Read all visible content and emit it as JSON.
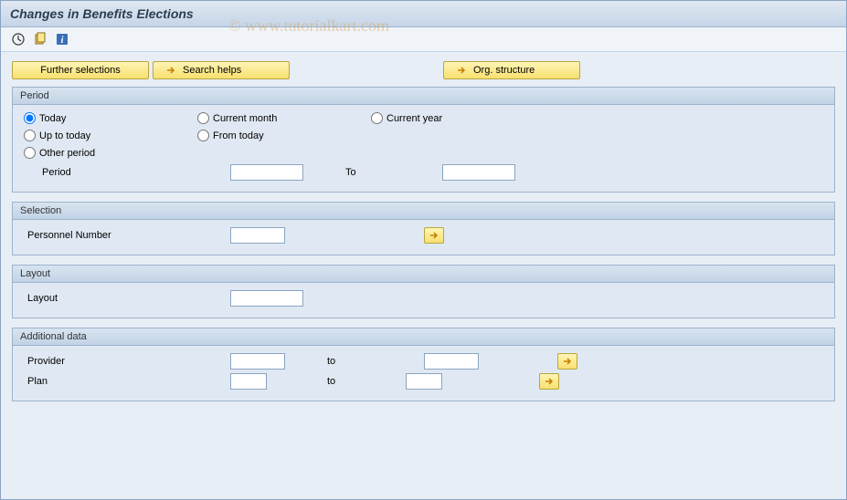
{
  "header": {
    "title": "Changes in Benefits Elections"
  },
  "watermark": "© www.tutorialkart.com",
  "toolbar": {
    "icons": [
      "clock-icon",
      "variant-icon",
      "info-icon"
    ]
  },
  "buttons": {
    "further_selections": "Further selections",
    "search_helps": "Search helps",
    "org_structure": "Org. structure"
  },
  "period_group": {
    "title": "Period",
    "radios": {
      "today": "Today",
      "current_month": "Current month",
      "current_year": "Current year",
      "up_to_today": "Up to today",
      "from_today": "From today",
      "other_period": "Other period"
    },
    "selected": "today",
    "period_label": "Period",
    "period_from": "",
    "to_label": "To",
    "period_to": ""
  },
  "selection_group": {
    "title": "Selection",
    "personnel_number_label": "Personnel Number",
    "personnel_number_value": ""
  },
  "layout_group": {
    "title": "Layout",
    "layout_label": "Layout",
    "layout_value": ""
  },
  "additional_group": {
    "title": "Additional data",
    "provider_label": "Provider",
    "provider_from": "",
    "provider_to": "",
    "plan_label": "Plan",
    "plan_from": "",
    "plan_to": "",
    "to_label": "to"
  }
}
